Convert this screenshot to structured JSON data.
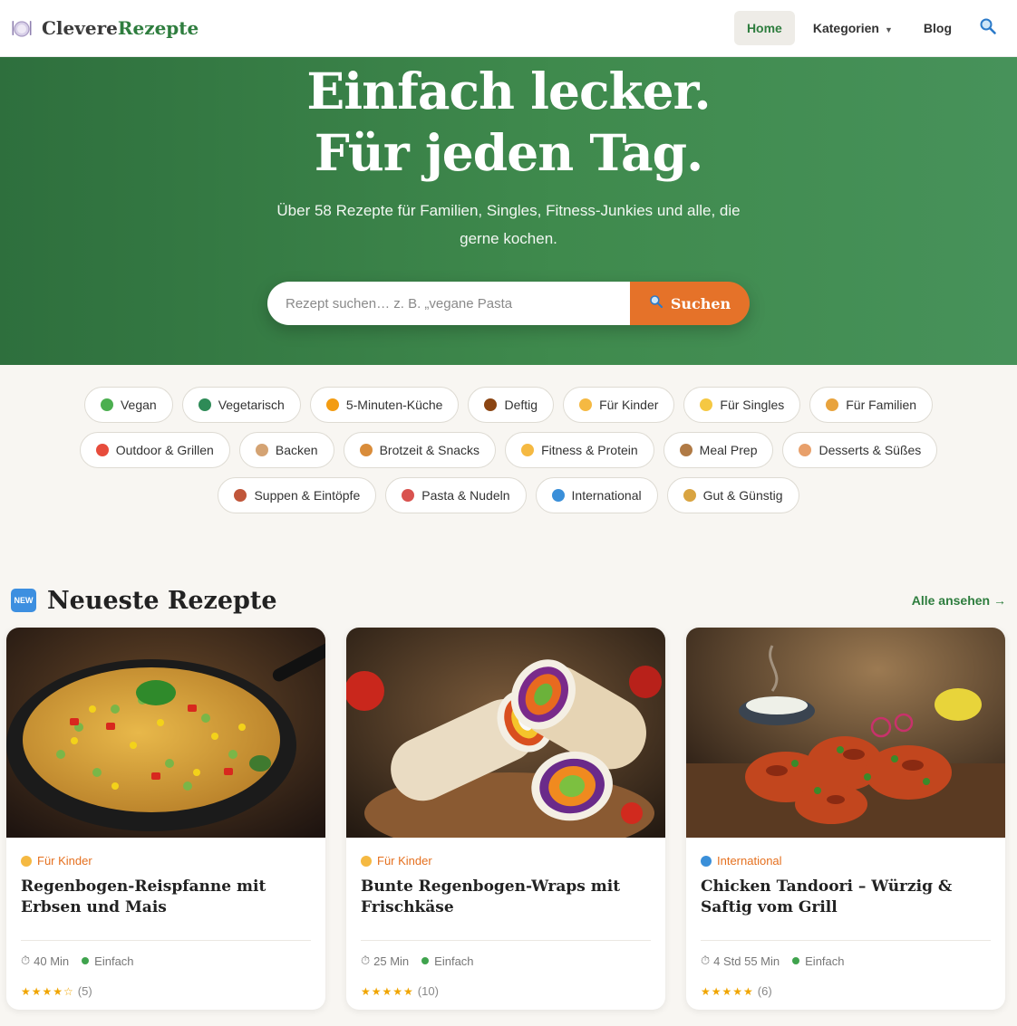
{
  "header": {
    "logo_part1": "Clevere",
    "logo_part2": "Rezepte",
    "nav": {
      "home": "Home",
      "kategorien": "Kategorien",
      "blog": "Blog"
    }
  },
  "hero": {
    "title_line1": "Einfach lecker.",
    "title_line2": "Für jeden Tag.",
    "subtitle": "Über 58 Rezepte für Familien, Singles, Fitness-Junkies und alle, die gerne kochen.",
    "search_placeholder": "Rezept suchen… z. B. „vegane Pasta",
    "search_button": "Suchen"
  },
  "chips": {
    "row1": [
      {
        "label": "Vegan",
        "icon": "seedling-icon",
        "color": "#4caf50"
      },
      {
        "label": "Vegetarisch",
        "icon": "broccoli-icon",
        "color": "#2e8b57"
      },
      {
        "label": "5-Minuten-Küche",
        "icon": "lightning-icon",
        "color": "#f39c12"
      },
      {
        "label": "Deftig",
        "icon": "meat-icon",
        "color": "#8b4513"
      },
      {
        "label": "Für Kinder",
        "icon": "child-icon",
        "color": "#f5b942"
      },
      {
        "label": "Für Singles",
        "icon": "person-icon",
        "color": "#f5c842"
      },
      {
        "label": "Für Familien",
        "icon": "family-icon",
        "color": "#e8a33d"
      }
    ],
    "row2": [
      {
        "label": "Outdoor & Grillen",
        "icon": "fire-icon",
        "color": "#e74c3c"
      },
      {
        "label": "Backen",
        "icon": "cake-icon",
        "color": "#d4a373"
      },
      {
        "label": "Brotzeit & Snacks",
        "icon": "croissant-icon",
        "color": "#d98c3a"
      },
      {
        "label": "Fitness & Protein",
        "icon": "muscle-icon",
        "color": "#f5b942"
      },
      {
        "label": "Meal Prep",
        "icon": "box-icon",
        "color": "#b07a45"
      },
      {
        "label": "Desserts & Süßes",
        "icon": "pie-icon",
        "color": "#e8a06b"
      }
    ],
    "row3": [
      {
        "label": "Suppen & Eintöpfe",
        "icon": "soup-icon",
        "color": "#c0563a"
      },
      {
        "label": "Pasta & Nudeln",
        "icon": "pasta-icon",
        "color": "#d9534f"
      },
      {
        "label": "International",
        "icon": "globe-icon",
        "color": "#3a8fd9"
      },
      {
        "label": "Gut & Günstig",
        "icon": "money-bag-icon",
        "color": "#d9a441"
      }
    ]
  },
  "section": {
    "badge": "NEW",
    "title": "Neueste Rezepte",
    "see_all": "Alle ansehen →"
  },
  "cards": [
    {
      "category": "Für Kinder",
      "category_icon": "child-icon",
      "title": "Regenbogen-Reispfanne mit Erbsen und Mais",
      "time": "40 Min",
      "difficulty": "Einfach",
      "stars": "★★★★☆",
      "reviews": "(5)",
      "image": "rice-pan-image"
    },
    {
      "category": "Für Kinder",
      "category_icon": "child-icon",
      "title": "Bunte Regenbogen-Wraps mit Frischkäse",
      "time": "25 Min",
      "difficulty": "Einfach",
      "stars": "★★★★★",
      "reviews": "(10)",
      "image": "wraps-image"
    },
    {
      "category": "International",
      "category_icon": "globe-icon",
      "title": "Chicken Tandoori – Würzig & Saftig vom Grill",
      "time": "4 Std 55 Min",
      "difficulty": "Einfach",
      "stars": "★★★★★",
      "reviews": "(6)",
      "image": "tandoori-chicken-image"
    }
  ]
}
